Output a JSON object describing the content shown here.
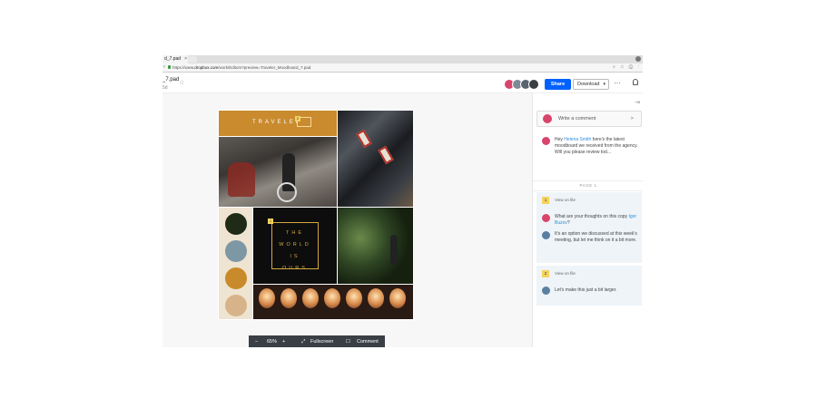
{
  "browser": {
    "tab_title": "d_7.pad",
    "tab_close": "×",
    "url_scheme": "https://www.",
    "url_domain": "dropbox.com",
    "url_path": "/work/Editors?preview=Traveler_Moodboard_7.pad",
    "nav_glyphs": "‹ ›",
    "ext_glyphs": "⌕ ☆ ⓘ ⋮"
  },
  "header": {
    "file_name": "_7.pad",
    "file_sub": "5d",
    "star": "☆",
    "share_label": "Share",
    "download_label": "Download",
    "download_caret": "▾",
    "more_label": "···",
    "avatar_colors": [
      "#d9446b",
      "#7d8a96",
      "#5a6470",
      "#3b3f44"
    ]
  },
  "moodboard": {
    "banner_text": "TRAVELER",
    "banner_marker": "2",
    "world_marker": "1",
    "world_lines": [
      "THE",
      "WORLD",
      "IS",
      "OURS"
    ],
    "swatch_colors": [
      "#1f2a17",
      "#7e97a5",
      "#c88a2a",
      "#d7b38a"
    ]
  },
  "toolbar": {
    "zoom_out": "−",
    "zoom_level": "65%",
    "zoom_in": "+",
    "fullscreen_label": "Fullscreen",
    "comment_label": "Comment",
    "fullscreen_glyph": "⤢",
    "comment_glyph": "☐"
  },
  "sidebar": {
    "collapse_glyph": "⇥",
    "write_placeholder": "Write a comment",
    "send_glyph": "➤",
    "first_comment": {
      "prefix": "Hey ",
      "mention": "Helena Smith",
      "suffix": " here's the latest moodboard we received from the agency. Will you please review tod..."
    },
    "page_label": "PAGE 1",
    "threads": [
      {
        "number": "1",
        "view_label": "View on file",
        "comments": [
          {
            "prefix": "What are your thoughts on this copy ",
            "mention": "Igor Buzov",
            "suffix": "?"
          },
          {
            "prefix": "It's an option we discussed at this week's meeting, but let me think on it a bit more.",
            "mention": "",
            "suffix": ""
          }
        ]
      },
      {
        "number": "2",
        "view_label": "View on file",
        "comments": [
          {
            "prefix": "Let's make this just a bit larger.",
            "mention": "",
            "suffix": ""
          }
        ]
      }
    ]
  },
  "colors": {
    "accent_blue": "#0061fe",
    "marker_yellow": "#f4d35e",
    "mention_blue": "#2f8fdd",
    "thread_bg": "#eef4f8"
  }
}
